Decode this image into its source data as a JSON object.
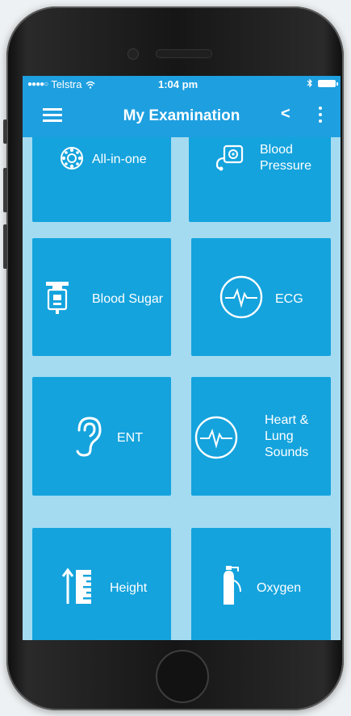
{
  "status_bar": {
    "signal": "●●●●○",
    "carrier": "Telstra",
    "wifi": "wifi-icon",
    "time": "1:04 pm",
    "bluetooth": "bluetooth-icon",
    "battery": "battery-icon"
  },
  "nav": {
    "title": "My Examination",
    "menu_icon": "hamburger-menu-icon",
    "back": "<",
    "more_icon": "vertical-dots-icon"
  },
  "tiles": [
    {
      "label": "All-in-one",
      "icon": "all-in-one-icon"
    },
    {
      "label": "Blood Pressure",
      "line1": "Blood",
      "line2": "Pressure",
      "icon": "blood-pressure-icon"
    },
    {
      "label": "Blood Sugar",
      "icon": "glucose-meter-icon"
    },
    {
      "label": "ECG",
      "icon": "ecg-icon"
    },
    {
      "label": "ENT",
      "icon": "ear-icon"
    },
    {
      "label": "Heart & Lung Sounds",
      "line1": "Heart &",
      "line2": "Lung",
      "line3": "Sounds",
      "icon": "heart-lung-icon"
    },
    {
      "label": "Height",
      "icon": "height-ruler-icon"
    },
    {
      "label": "Oxygen",
      "icon": "oxygen-tank-icon"
    }
  ],
  "colors": {
    "header": "#1e9fe0",
    "tile": "#14a3dd",
    "background": "#a4dbf1"
  }
}
